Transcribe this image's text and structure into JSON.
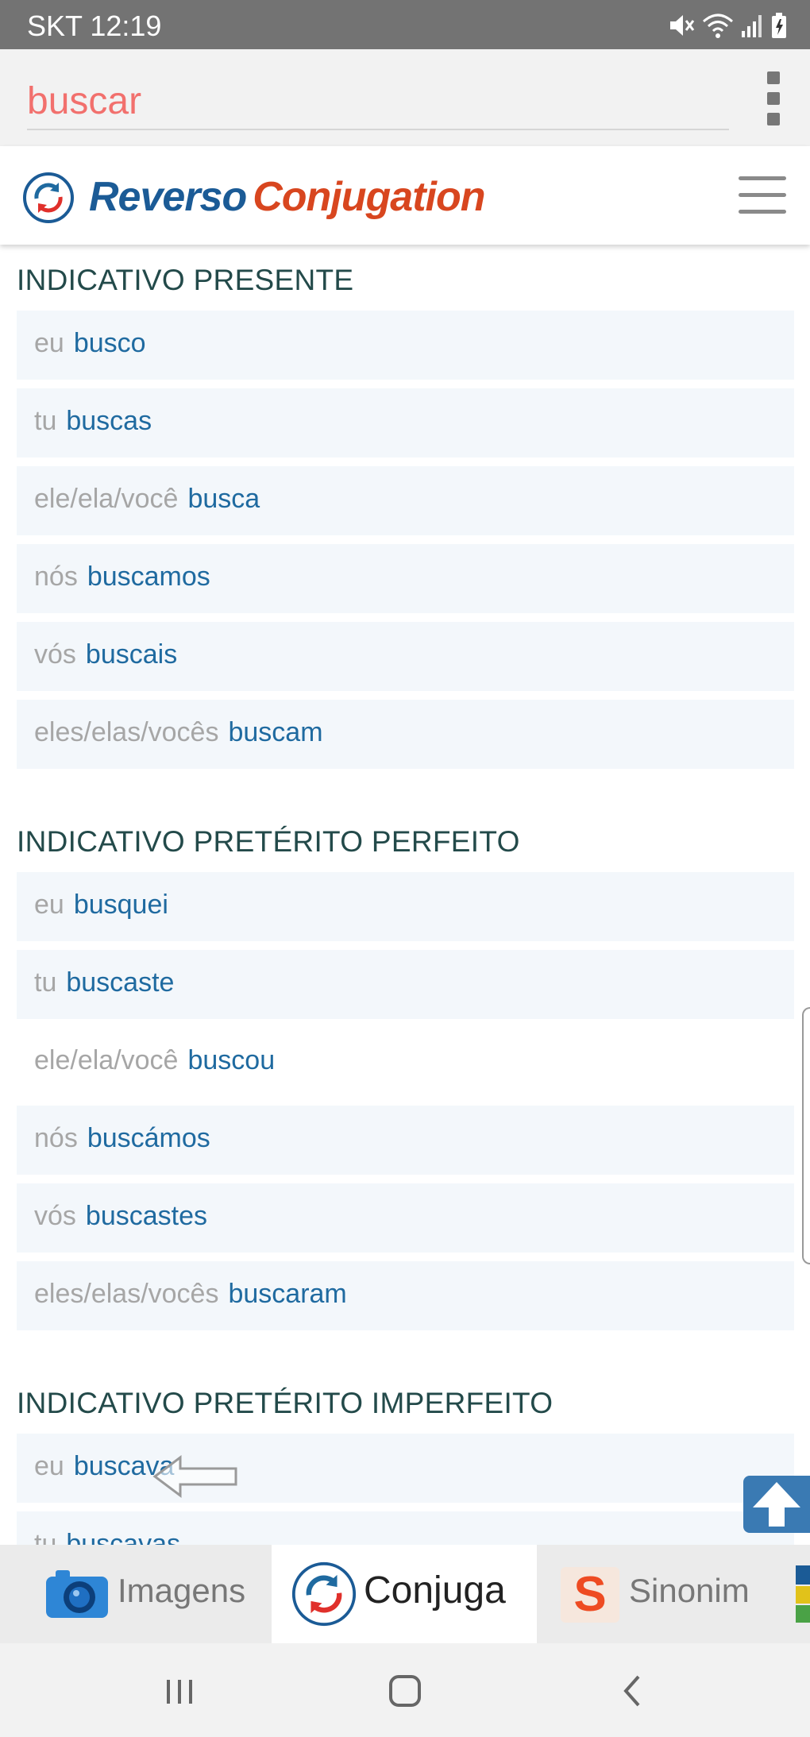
{
  "status_bar": {
    "carrier_time": "SKT 12:19",
    "icons": [
      "mute-icon",
      "wifi-icon",
      "signal-icon",
      "battery-charging-icon"
    ]
  },
  "search": {
    "query": "buscar",
    "more_icon": "more-vert-icon"
  },
  "header": {
    "brand_part1": "Reverso",
    "brand_part2": "Conjugation",
    "menu_icon": "hamburger-menu-icon",
    "colors": {
      "brand_blue": "#1b5b96",
      "brand_red": "#d8461f"
    }
  },
  "sections": [
    {
      "title": "INDICATIVO PRESENTE",
      "rows": [
        {
          "pronoun": "eu",
          "form": "busco"
        },
        {
          "pronoun": "tu",
          "form": "buscas"
        },
        {
          "pronoun": "ele/ela/você",
          "form": "busca"
        },
        {
          "pronoun": "nós",
          "form": "buscamos"
        },
        {
          "pronoun": "vós",
          "form": "buscais"
        },
        {
          "pronoun": "eles/elas/vocês",
          "form": "buscam"
        }
      ]
    },
    {
      "title": "INDICATIVO PRETÉRITO PERFEITO",
      "rows": [
        {
          "pronoun": "eu",
          "form": "busquei"
        },
        {
          "pronoun": "tu",
          "form": "buscaste"
        },
        {
          "pronoun": "ele/ela/você",
          "form": "buscou"
        },
        {
          "pronoun": "nós",
          "form": "buscámos"
        },
        {
          "pronoun": "vós",
          "form": "buscastes"
        },
        {
          "pronoun": "eles/elas/vocês",
          "form": "buscaram"
        }
      ]
    },
    {
      "title": "INDICATIVO PRETÉRITO IMPERFEITO",
      "rows": [
        {
          "pronoun": "eu",
          "form": "buscava"
        },
        {
          "pronoun": "tu",
          "form": "buscavas"
        }
      ]
    }
  ],
  "scroll_top_icon": "arrow-up-icon",
  "bottom_tabs": [
    {
      "label": "Imagens",
      "icon": "camera-icon"
    },
    {
      "label": "Conjuga",
      "icon": "reverso-logo-icon"
    },
    {
      "label": "Sinonim",
      "icon": "synonym-s-icon"
    }
  ],
  "nav_bar": {
    "icons": [
      "recent-apps-icon",
      "home-icon",
      "back-icon"
    ]
  },
  "colors": {
    "accent_blue": "#1f6aa0",
    "row_bg": "#f3f7fb",
    "section_title": "#234a4a",
    "query_text": "#f2706d"
  }
}
